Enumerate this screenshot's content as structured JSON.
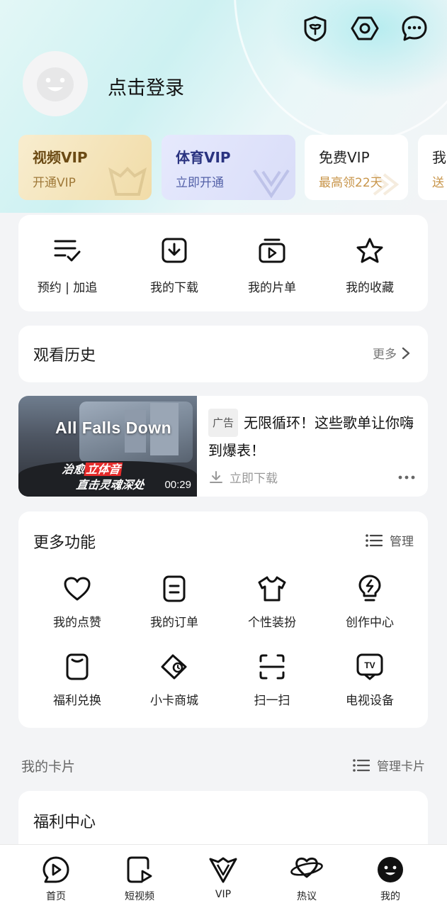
{
  "header": {
    "login_text": "点击登录",
    "icons": [
      "shield-icon",
      "settings-icon",
      "message-icon"
    ]
  },
  "vip_cards": [
    {
      "title": "视频VIP",
      "subtitle": "开通VIP",
      "bg": "#f6e7c1",
      "title_color": "#6b4a14",
      "sub_color": "#a07a3a"
    },
    {
      "title": "体育VIP",
      "subtitle": "立即开通",
      "bg": "#e2e5fb",
      "title_color": "#2a3380",
      "sub_color": "#5461a8"
    },
    {
      "title": "免费VIP",
      "subtitle": "最高领22天",
      "bg": "#ffffff",
      "title_color": "#222222",
      "sub_color": "#c8954a"
    },
    {
      "title": "我",
      "subtitle": "送",
      "bg": "#ffffff",
      "title_color": "#222222",
      "sub_color": "#c8954a"
    }
  ],
  "quick_actions": [
    {
      "label": "预约 | 加追",
      "icon": "list-check-icon"
    },
    {
      "label": "我的下载",
      "icon": "download-icon"
    },
    {
      "label": "我的片单",
      "icon": "playlist-icon"
    },
    {
      "label": "我的收藏",
      "icon": "star-icon"
    }
  ],
  "history": {
    "title": "观看历史",
    "more": "更多"
  },
  "ad": {
    "badge": "广告",
    "text": "无限循环！这些歌单让你嗨到爆表！",
    "download": "立即下载",
    "thumb_title": "All Falls Down",
    "thumb_line1_prefix": "治愈",
    "thumb_line1_highlight": "立体音",
    "thumb_line2": "直击灵魂深处",
    "duration": "00:29"
  },
  "more_functions": {
    "title": "更多功能",
    "manage": "管理",
    "items": [
      {
        "label": "我的点赞",
        "icon": "heart-icon"
      },
      {
        "label": "我的订单",
        "icon": "order-icon"
      },
      {
        "label": "个性装扮",
        "icon": "tshirt-icon"
      },
      {
        "label": "创作中心",
        "icon": "lightbulb-icon"
      },
      {
        "label": "福利兑换",
        "icon": "exchange-icon"
      },
      {
        "label": "小卡商城",
        "icon": "card-shop-icon"
      },
      {
        "label": "扫一扫",
        "icon": "scan-icon"
      },
      {
        "label": "电视设备",
        "icon": "tv-icon"
      }
    ]
  },
  "my_cards": {
    "title": "我的卡片",
    "manage": "管理卡片"
  },
  "welfare": {
    "title": "福利中心"
  },
  "tabbar": [
    {
      "label": "首页",
      "icon": "home-play-icon"
    },
    {
      "label": "短视频",
      "icon": "short-video-icon"
    },
    {
      "label": "VIP",
      "icon": "vip-icon"
    },
    {
      "label": "热议",
      "icon": "planet-icon"
    },
    {
      "label": "我的",
      "icon": "profile-icon"
    }
  ]
}
